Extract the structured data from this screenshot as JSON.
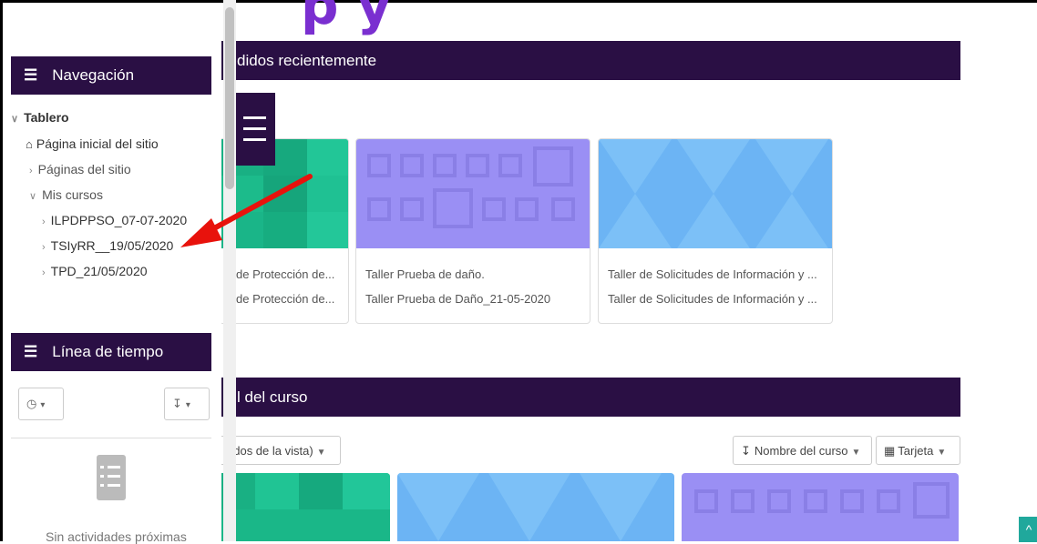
{
  "main": {
    "recent_heading": "didos recientemente",
    "course_heading": "l del curso",
    "recent_cards": [
      {
        "line1": "de Protección de...",
        "line2": "de Protección de...",
        "color": "#1dbf8e"
      },
      {
        "line1": "Taller Prueba de daño.",
        "line2": "Taller Prueba de Daño_21-05-2020",
        "color": "#9a8ff4"
      },
      {
        "line1": "Taller de Solicitudes de Información y ...",
        "line2": "Taller de Solicitudes de Información y ...",
        "color": "#6cb4f4"
      }
    ],
    "filter_label": "ados de la vista)",
    "sort_label": "Nombre del curso",
    "view_label": "Tarjeta"
  },
  "sidebar": {
    "nav_title": "Navegación",
    "items": [
      {
        "label": "Tablero"
      },
      {
        "label": "Página inicial del sitio"
      },
      {
        "label": "Páginas del sitio"
      },
      {
        "label": "Mis cursos"
      },
      {
        "label": "ILPDPPSO_07-07-2020"
      },
      {
        "label": "TSIyRR__19/05/2020"
      },
      {
        "label": "TPD_21/05/2020"
      }
    ],
    "timeline_title": "Línea de tiempo",
    "empty_text": "Sin actividades próximas"
  },
  "colors": {
    "brand_dark": "#2a0f44",
    "annotation": "#e8120c"
  },
  "icons": [
    "menu-icon",
    "home-icon",
    "clock-icon",
    "sort-icon",
    "grid-icon",
    "document-icon",
    "arrow-up-icon"
  ]
}
